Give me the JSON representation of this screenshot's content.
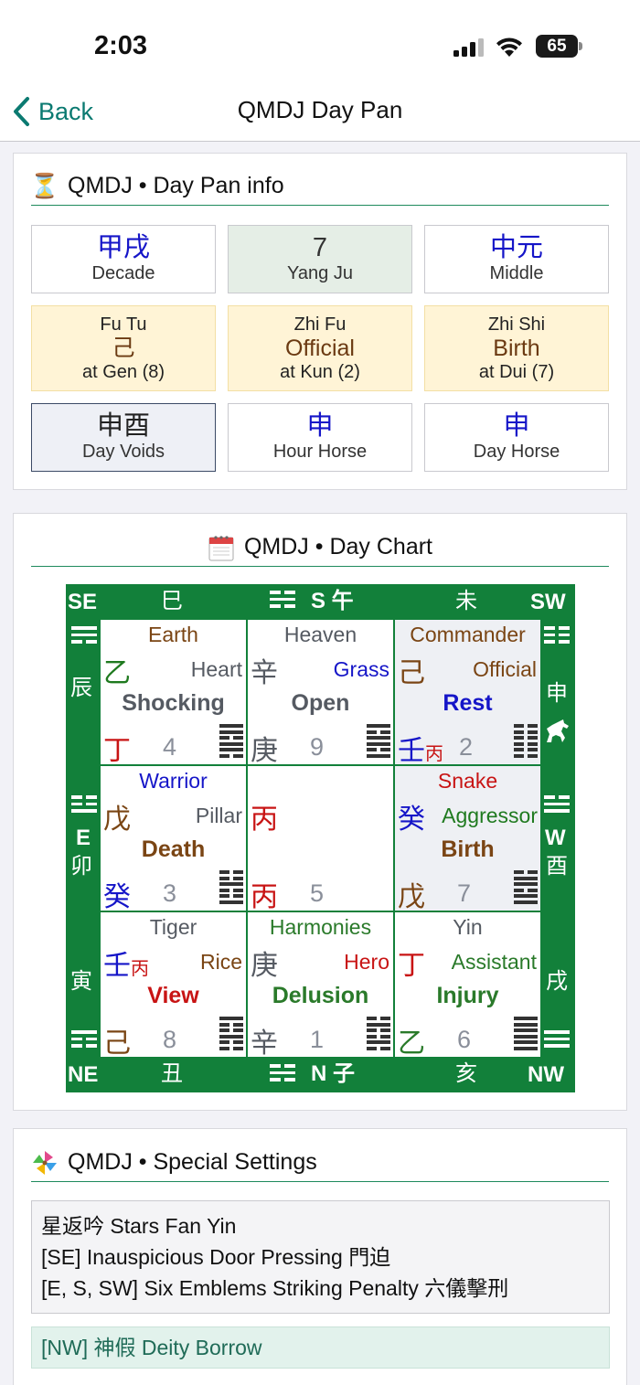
{
  "status_bar": {
    "time": "2:03",
    "battery": "65"
  },
  "nav": {
    "back_label": "Back",
    "title": "QMDJ Day Pan"
  },
  "info_card": {
    "title": "QMDJ • Day Pan info",
    "icon": "hourglass-icon",
    "row1": [
      {
        "value": "甲戌",
        "label": "Decade"
      },
      {
        "value": "7",
        "label": "Yang Ju"
      },
      {
        "value": "中元",
        "label": "Middle"
      }
    ],
    "row2": [
      {
        "title": "Fu Tu",
        "value": "己",
        "location": "at Gen (8)"
      },
      {
        "title": "Zhi Fu",
        "value": "Official",
        "location": "at Kun (2)"
      },
      {
        "title": "Zhi Shi",
        "value": "Birth",
        "location": "at Dui (7)"
      }
    ],
    "row3": [
      {
        "value": "申酉",
        "label": "Day Voids"
      },
      {
        "value": "申",
        "label": "Hour Horse"
      },
      {
        "value": "申",
        "label": "Day Horse"
      }
    ]
  },
  "chart_card": {
    "title": "QMDJ • Day Chart",
    "icon": "calendar-icon",
    "outer": {
      "se": "SE",
      "sw": "SW",
      "ne": "NE",
      "nw": "NW",
      "top_left_branch": "巳",
      "top_mid": "S 午",
      "top_right_branch": "未",
      "bottom_left_branch": "丑",
      "bottom_mid": "N 子",
      "bottom_right_branch": "亥",
      "left_top_branch": "辰",
      "left_mid_e": "E",
      "left_mid_branch": "卯",
      "left_bottom_branch": "寅",
      "right_top_branch": "申",
      "right_mid_w": "W",
      "right_mid_branch": "酉",
      "right_bottom_branch": "戌",
      "horse_icon": "horse-icon"
    },
    "palaces": [
      {
        "deity": "Earth",
        "heaven_stem": "乙",
        "star": "Heart",
        "door": "Shocking",
        "earth_stem": "丁",
        "number": "4"
      },
      {
        "deity": "Heaven",
        "heaven_stem": "辛",
        "star": "Grass",
        "door": "Open",
        "earth_stem": "庚",
        "number": "9"
      },
      {
        "deity": "Commander",
        "heaven_stem": "己",
        "star": "Official",
        "door": "Rest",
        "earth_stem": "壬",
        "earth_stem_sub": "丙",
        "number": "2"
      },
      {
        "deity": "Warrior",
        "heaven_stem": "戊",
        "star": "Pillar",
        "door": "Death",
        "earth_stem": "癸",
        "number": "3"
      },
      {
        "deity": "",
        "heaven_stem": "丙",
        "star": "",
        "door": "",
        "earth_stem": "丙",
        "number": "5"
      },
      {
        "deity": "Snake",
        "heaven_stem": "癸",
        "star": "Aggressor",
        "door": "Birth",
        "earth_stem": "戊",
        "number": "7"
      },
      {
        "deity": "Tiger",
        "heaven_stem": "壬",
        "heaven_stem_sub": "丙",
        "star": "Rice",
        "door": "View",
        "earth_stem": "己",
        "number": "8"
      },
      {
        "deity": "Harmonies",
        "heaven_stem": "庚",
        "star": "Hero",
        "door": "Delusion",
        "earth_stem": "辛",
        "number": "1"
      },
      {
        "deity": "Yin",
        "heaven_stem": "丁",
        "star": "Assistant",
        "door": "Injury",
        "earth_stem": "乙",
        "number": "6"
      }
    ]
  },
  "special_card": {
    "title": "QMDJ • Special Settings",
    "icon": "pinwheel-icon",
    "lines": [
      "星返吟 Stars Fan Yin",
      "[SE] Inauspicious Door Pressing 門迫",
      "[E, S, SW] Six Emblems Striking Penalty 六儀擊刑"
    ],
    "highlight": "[NW] 神假 Deity Borrow"
  },
  "colors": {
    "accent": "#0b7a71",
    "chart_green": "#12803a",
    "blue_text": "#1515c8",
    "red_text": "#c81414",
    "brown_text": "#7a4514"
  }
}
